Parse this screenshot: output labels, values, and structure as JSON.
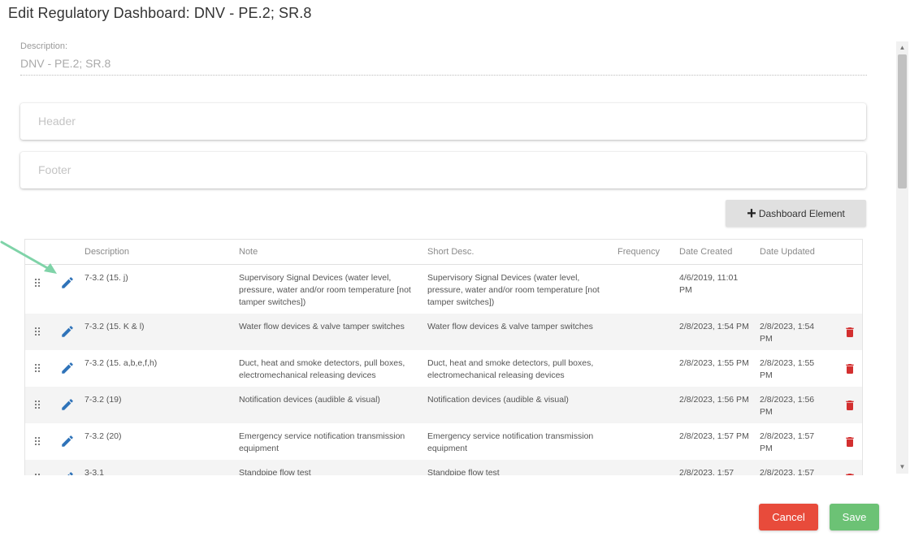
{
  "title": "Edit Regulatory Dashboard: DNV - PE.2; SR.8",
  "description": {
    "label": "Description:",
    "value": "DNV - PE.2; SR.8"
  },
  "header_placeholder": "Header",
  "footer_placeholder": "Footer",
  "add_button_label": "Dashboard Element",
  "table": {
    "columns": [
      "Description",
      "Note",
      "Short Desc.",
      "Frequency",
      "Date Created",
      "Date Updated"
    ],
    "rows": [
      {
        "description": "7-3.2 (15. j)",
        "note": "Supervisory Signal Devices (water level, pressure, water and/or room temperature [not tamper switches])",
        "short_desc": "Supervisory Signal Devices (water level, pressure, water and/or room temperature [not tamper switches])",
        "frequency": "",
        "date_created": "4/6/2019, 11:01 PM",
        "date_updated": ""
      },
      {
        "description": "7-3.2 (15. K & l)",
        "note": "Water flow devices & valve tamper switches",
        "short_desc": "Water flow devices & valve tamper switches",
        "frequency": "",
        "date_created": "2/8/2023, 1:54 PM",
        "date_updated": "2/8/2023, 1:54 PM"
      },
      {
        "description": "7-3.2 (15. a,b,e,f,h)",
        "note": "Duct, heat and smoke detectors, pull boxes, electromechanical releasing devices",
        "short_desc": "Duct, heat and smoke detectors, pull boxes, electromechanical releasing devices",
        "frequency": "",
        "date_created": "2/8/2023, 1:55 PM",
        "date_updated": "2/8/2023, 1:55 PM"
      },
      {
        "description": "7-3.2 (19)",
        "note": "Notification devices (audible & visual)",
        "short_desc": "Notification devices (audible & visual)",
        "frequency": "",
        "date_created": "2/8/2023, 1:56 PM",
        "date_updated": "2/8/2023, 1:56 PM"
      },
      {
        "description": "7-3.2 (20)",
        "note": "Emergency service notification transmission equipment",
        "short_desc": "Emergency service notification transmission equipment",
        "frequency": "",
        "date_created": "2/8/2023, 1:57 PM",
        "date_updated": "2/8/2023, 1:57 PM"
      },
      {
        "description": "3-3.1",
        "note": "Standpipe flow test",
        "short_desc": "Standpipe flow test",
        "frequency": "",
        "date_created": "2/8/2023, 1:57",
        "date_updated": "2/8/2023, 1:57"
      }
    ]
  },
  "buttons": {
    "cancel": "Cancel",
    "save": "Save"
  },
  "colors": {
    "edit_icon": "#2f73b9",
    "trash_icon": "#d32f2f",
    "cancel": "#e84b3b",
    "save": "#6cc275",
    "arrow": "#7fd3a8"
  },
  "icons": {
    "edit": "pencil-icon",
    "delete": "trash-icon",
    "drag": "drag-handle-icon",
    "add": "plus-icon"
  }
}
